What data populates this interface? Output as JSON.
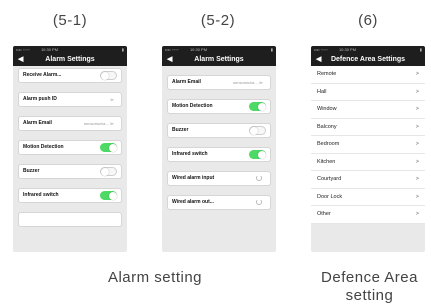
{
  "captions": {
    "fig1": "(5-1)",
    "fig2": "(5-2)",
    "fig3": "(6)",
    "alarm": "Alarm setting",
    "defence_line1": "Defence Area",
    "defence_line2": "setting"
  },
  "status_bar": {
    "carrier": "•••• ◦◦◦◦◦",
    "time": "10:30 PM",
    "battery": "▮"
  },
  "screen1": {
    "title": "Alarm Settings",
    "back": "◀",
    "rows": [
      {
        "label": "Receive Alarm...",
        "value": ""
      },
      {
        "label": "Alarm push ID",
        "value": "≫"
      },
      {
        "label": "Alarm Email",
        "value": "sensorsicha... ≫"
      },
      {
        "label": "Motion Detection",
        "value": ""
      },
      {
        "label": "Buzzer",
        "value": ""
      },
      {
        "label": "Infrared switch",
        "value": ""
      }
    ],
    "toggles": {
      "receive_alarm": false,
      "motion_detection": true,
      "buzzer": false,
      "infrared_switch": true
    }
  },
  "screen2": {
    "title": "Alarm Settings",
    "back": "◀",
    "rows": [
      {
        "label": "Alarm Email",
        "value": "sensorsicha... ≫"
      },
      {
        "label": "Motion Detection",
        "value": ""
      },
      {
        "label": "Buzzer",
        "value": ""
      },
      {
        "label": "Infrared switch",
        "value": ""
      },
      {
        "label": "Wired alarm input",
        "value": ""
      },
      {
        "label": "Wired alarm out...",
        "value": ""
      }
    ],
    "toggles": {
      "motion_detection": true,
      "buzzer": false,
      "infrared_switch": true
    }
  },
  "screen3": {
    "title": "Defence Area Settings",
    "back": "◀",
    "areas": [
      {
        "name": "Remote",
        "chevron": ">"
      },
      {
        "name": "Hall",
        "chevron": ">"
      },
      {
        "name": "Window",
        "chevron": ">"
      },
      {
        "name": "Balcony",
        "chevron": ">"
      },
      {
        "name": "Bedroom",
        "chevron": ">"
      },
      {
        "name": "Kitchen",
        "chevron": ">"
      },
      {
        "name": "Courtyard",
        "chevron": ">"
      },
      {
        "name": "Door Lock",
        "chevron": ">"
      },
      {
        "name": "Other",
        "chevron": ">"
      }
    ]
  },
  "colors": {
    "nav_bg": "#1e1e1e",
    "toggle_on": "#4cd964",
    "screen_bg": "#e9e9e9"
  }
}
